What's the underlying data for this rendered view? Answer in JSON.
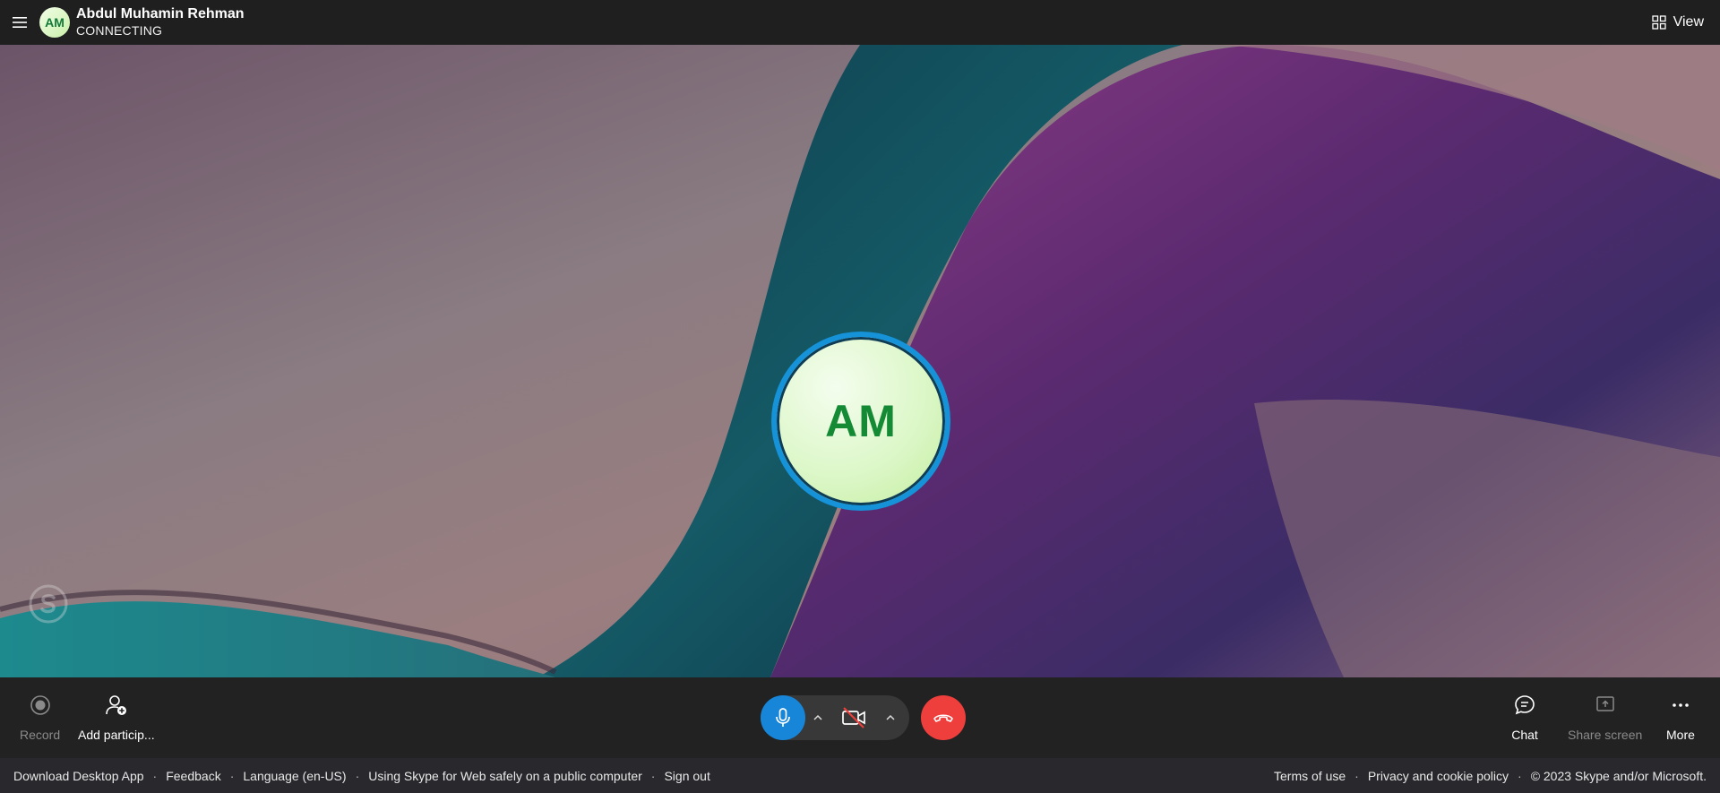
{
  "header": {
    "avatar_initials": "AM",
    "caller_name": "Abdul Muhamin Rehman",
    "status": "CONNECTING",
    "view_label": "View"
  },
  "stage": {
    "avatar_initials": "AM"
  },
  "controls": {
    "record_label": "Record",
    "add_participants_label": "Add particip...",
    "chat_label": "Chat",
    "share_screen_label": "Share screen",
    "more_label": "More"
  },
  "footer": {
    "left_links": [
      "Download Desktop App",
      "Feedback",
      "Language (en-US)",
      "Using Skype for Web safely on a public computer",
      "Sign out"
    ],
    "right_links": [
      "Terms of use",
      "Privacy and cookie policy",
      "© 2023 Skype and/or Microsoft."
    ]
  },
  "colors": {
    "mic_button": "#1786d8",
    "hangup_button": "#ee3f3c",
    "avatar_ring": "#1592d8",
    "avatar_text": "#148a35"
  }
}
